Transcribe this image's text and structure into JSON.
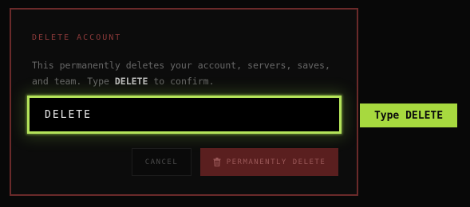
{
  "modal": {
    "title": "DELETE ACCOUNT",
    "description_line1": "This permanently deletes your account, servers, saves,",
    "description_line2_prefix": "and team. Type ",
    "description_keyword": "DELETE",
    "description_line2_suffix": " to confirm.",
    "confirm_input_value": "DELETE",
    "cancel_label": "CANCEL",
    "delete_label": "PERMANENTLY DELETE",
    "delete_icon": "trash-icon"
  },
  "callout": {
    "label": "Type DELETE"
  },
  "colors": {
    "background": "#080808",
    "modal_border": "#6a2a2a",
    "title": "#8c3a3a",
    "accent_green": "#b4e35a",
    "callout_bg": "#a7d93f",
    "danger_button_bg": "#5a1f1f",
    "danger_button_text": "#9a5858"
  }
}
